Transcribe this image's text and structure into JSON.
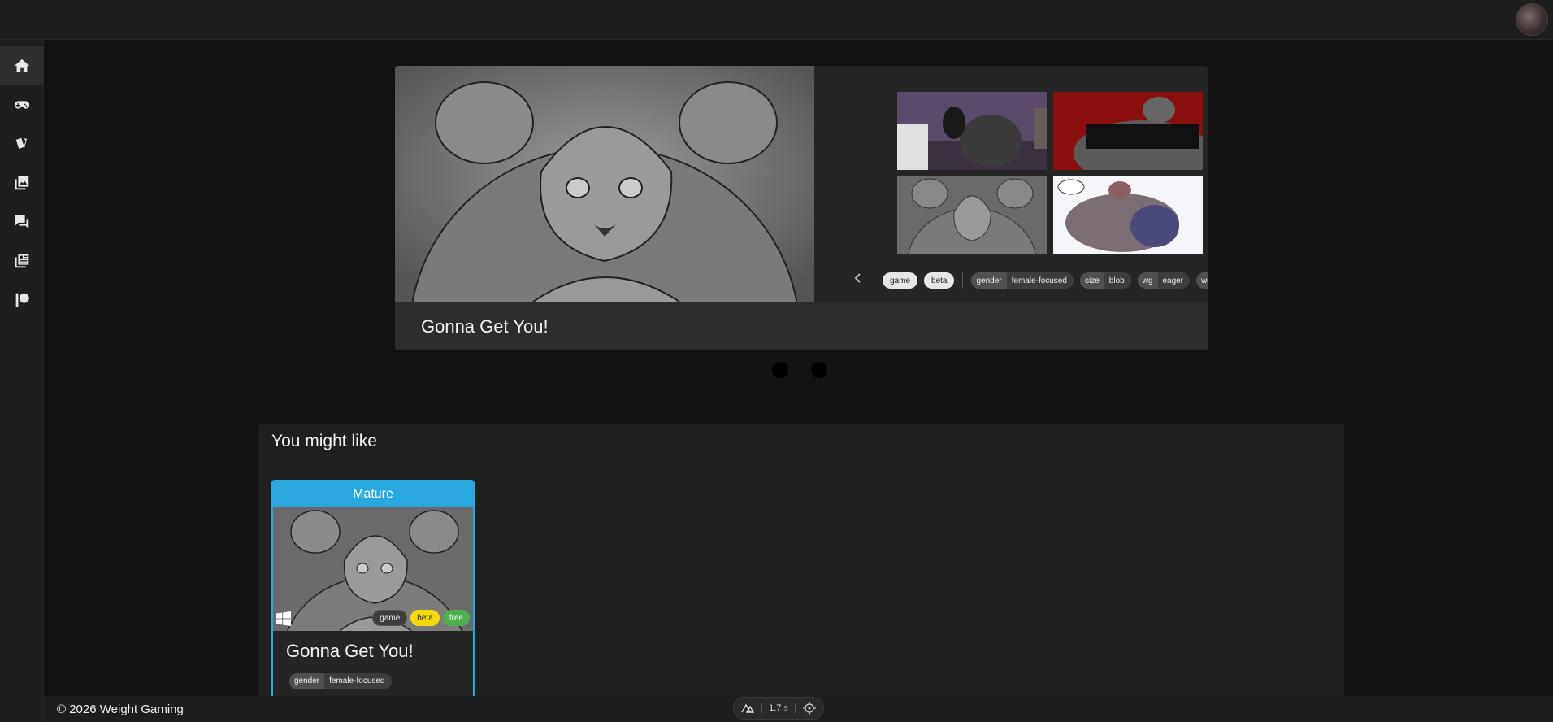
{
  "app": {
    "user_avatar_icon": "user-avatar-icon"
  },
  "sidebar": {
    "items": [
      {
        "name": "home",
        "icon": "home-icon",
        "active": true
      },
      {
        "name": "games",
        "icon": "gamepad-icon"
      },
      {
        "name": "cards",
        "icon": "cards-icon"
      },
      {
        "name": "gallery",
        "icon": "gallery-icon"
      },
      {
        "name": "forum",
        "icon": "forum-icon"
      },
      {
        "name": "news",
        "icon": "news-icon"
      },
      {
        "name": "patreon",
        "icon": "patreon-icon"
      }
    ]
  },
  "featured": {
    "title": "Gonna Get You!",
    "tags": [
      "game",
      "beta"
    ],
    "kv_tags": [
      {
        "key": "gender",
        "value": "female-focused"
      },
      {
        "key": "size",
        "value": "blob"
      },
      {
        "key": "wg",
        "value": "eager"
      },
      {
        "key": "wg",
        "value": ""
      }
    ],
    "slides": 2
  },
  "recommendations": {
    "heading": "You might like",
    "cards": [
      {
        "banner": "Mature",
        "title": "Gonna Get You!",
        "platform_icon": "windows-icon",
        "pills": [
          "game",
          "beta",
          "free"
        ],
        "tag": {
          "key": "gender",
          "value": "female-focused"
        }
      }
    ]
  },
  "footer": {
    "copyright": "© 2026 Weight Gaming"
  },
  "devbar": {
    "time_value": "1.7",
    "time_unit": "s"
  },
  "colors": {
    "accent": "#29a8e0",
    "beta": "#f5d90a",
    "free": "#4caf50",
    "background": "#121212"
  }
}
